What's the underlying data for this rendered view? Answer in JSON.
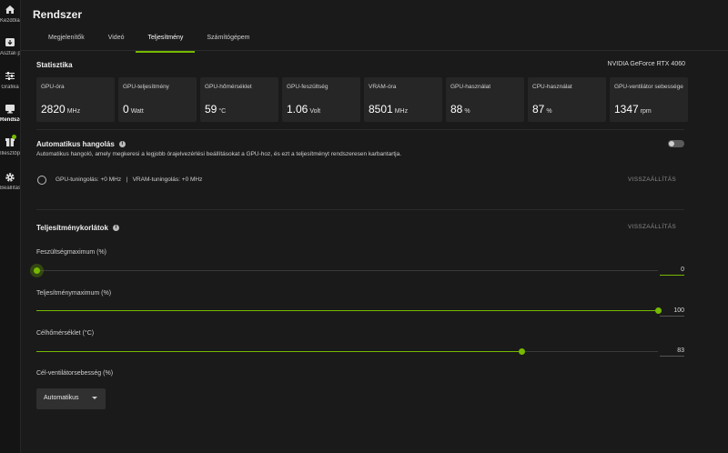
{
  "sidebar": {
    "items": [
      {
        "label": "Kezdőlap",
        "icon": "home-icon"
      },
      {
        "label": "Asztali programok",
        "icon": "download-icon"
      },
      {
        "label": "Grafika",
        "icon": "sliders-icon"
      },
      {
        "label": "Rendszer",
        "icon": "monitor-icon",
        "active": true
      },
      {
        "label": "Illesztőprogramok",
        "icon": "driver-icon",
        "badge": true
      },
      {
        "label": "Beállítások",
        "icon": "gear-icon"
      }
    ]
  },
  "header": {
    "title": "Rendszer"
  },
  "tabs": [
    {
      "label": "Megjelenítők"
    },
    {
      "label": "Videó"
    },
    {
      "label": "Teljesítmény",
      "active": true
    },
    {
      "label": "Számítógépem"
    }
  ],
  "stats": {
    "title": "Statisztika",
    "gpu_name": "NVIDIA GeForce RTX 4060",
    "cards": [
      {
        "label": "GPU-óra",
        "value": "2820",
        "unit": "MHz"
      },
      {
        "label": "GPU-teljesítmény",
        "value": "0",
        "unit": "Watt"
      },
      {
        "label": "GPU-hőmérséklet",
        "value": "59",
        "unit": "°C"
      },
      {
        "label": "GPU-feszültség",
        "value": "1.06",
        "unit": "Volt"
      },
      {
        "label": "VRAM-óra",
        "value": "8501",
        "unit": "MHz"
      },
      {
        "label": "GPU-használat",
        "value": "88",
        "unit": "%"
      },
      {
        "label": "CPU-használat",
        "value": "87",
        "unit": "%"
      },
      {
        "label": "GPU-ventilátor sebessége",
        "value": "1347",
        "unit": "rpm"
      }
    ]
  },
  "auto_tuning": {
    "title": "Automatikus hangolás",
    "description": "Automatikus hangoló, amely megkeresi a legjobb órajelvezérlési beállításokat a GPU-hoz, és ezt a teljesítményt rendszeresen karbantartja.",
    "enabled": false,
    "status": "GPU-tuningolás: +0 MHz   |   VRAM-tuningolás: +0 MHz",
    "reset_label": "VISSZAÁLLÍTÁS"
  },
  "limits": {
    "title": "Teljesítménykorlátok",
    "reset_label": "VISSZAÁLLÍTÁS",
    "sliders": [
      {
        "label": "Feszültségmaximum (%)",
        "value": "0",
        "fraction": 0.0
      },
      {
        "label": "Teljesítménymaximum (%)",
        "value": "100",
        "fraction": 1.0
      },
      {
        "label": "Célhőmérséklet (°C)",
        "value": "83",
        "fraction": 0.78
      }
    ],
    "fan_label": "Cél-ventilátorsebesség (%)",
    "fan_value": "Automatikus"
  },
  "colors": {
    "accent": "#76b900",
    "background": "#1a1a1a",
    "card": "#262626"
  }
}
